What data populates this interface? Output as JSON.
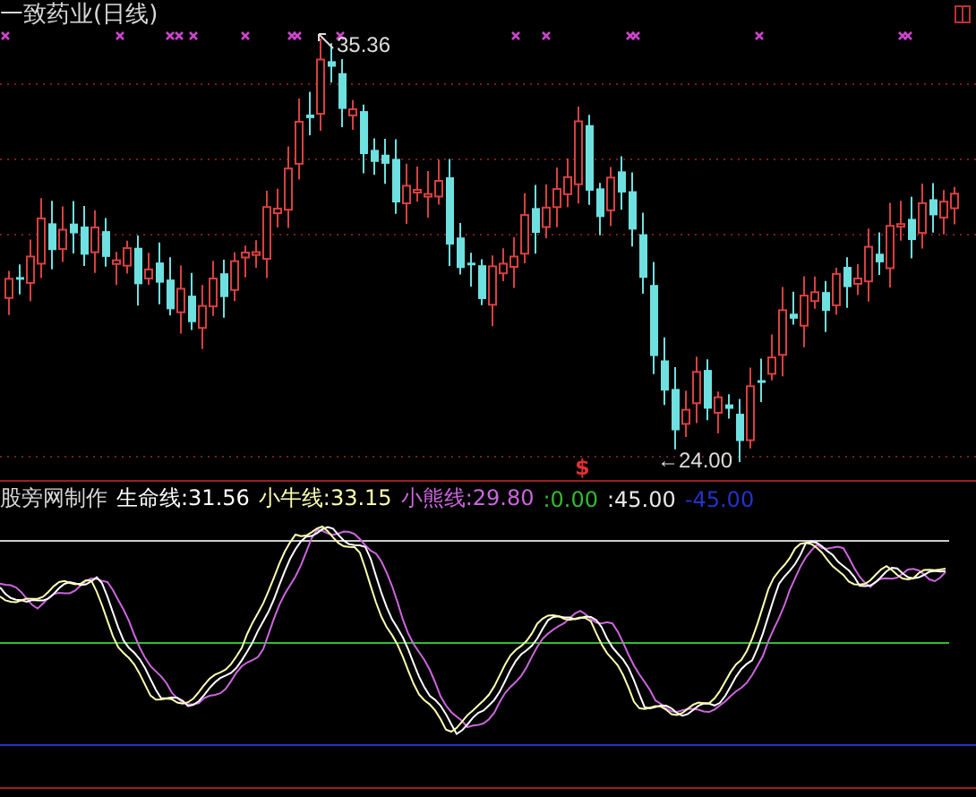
{
  "title": "一致药业(日线)",
  "price_labels": [
    {
      "kind": "high",
      "text": "35.36"
    },
    {
      "kind": "low",
      "text": "←24.00"
    }
  ],
  "signal_mark": "$",
  "legend": [
    {
      "text": "股旁网制作",
      "color": "#d8d8d8"
    },
    {
      "text": "生命线:31.56",
      "color": "#ffffff"
    },
    {
      "text": "小牛线:33.15",
      "color": "#ffffb0"
    },
    {
      "text": "小熊线:29.80",
      "color": "#cc66dd"
    },
    {
      "text": ":0.00",
      "color": "#33bb33"
    },
    {
      "text": ":45.00",
      "color": "#e8e8e8"
    },
    {
      "text": "-45.00",
      "color": "#2233cc"
    }
  ]
}
